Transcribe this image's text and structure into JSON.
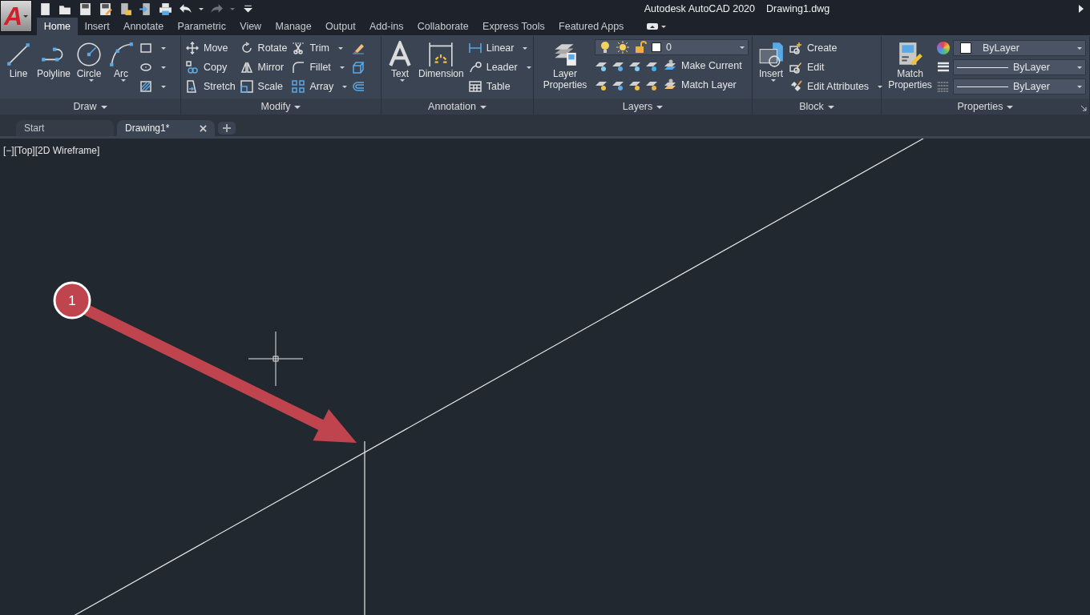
{
  "title_bar": {
    "app_button": "A",
    "product": "Autodesk AutoCAD 2020",
    "file": "Drawing1.dwg"
  },
  "ribbon_tabs": [
    {
      "label": "Home",
      "selected": true
    },
    {
      "label": "Insert",
      "selected": false
    },
    {
      "label": "Annotate",
      "selected": false
    },
    {
      "label": "Parametric",
      "selected": false
    },
    {
      "label": "View",
      "selected": false
    },
    {
      "label": "Manage",
      "selected": false
    },
    {
      "label": "Output",
      "selected": false
    },
    {
      "label": "Add-ins",
      "selected": false
    },
    {
      "label": "Collaborate",
      "selected": false
    },
    {
      "label": "Express Tools",
      "selected": false
    },
    {
      "label": "Featured Apps",
      "selected": false
    }
  ],
  "panels": [
    {
      "title": "Draw",
      "columns": [
        {
          "kind": "large",
          "label": "Line",
          "dropdown": false
        },
        {
          "kind": "large",
          "label": "Polyline",
          "dropdown": false
        },
        {
          "kind": "large",
          "label": "Circle",
          "dropdown": true
        },
        {
          "kind": "large",
          "label": "Arc",
          "dropdown": true
        },
        {
          "kind": "stack",
          "items": [
            {
              "dropdown": true
            },
            {
              "dropdown": true
            },
            {
              "dropdown": true
            }
          ]
        }
      ]
    },
    {
      "title": "Modify",
      "columns": [
        {
          "kind": "stack",
          "items": [
            {
              "label": "Move",
              "dropdown": false
            },
            {
              "label": "Copy",
              "dropdown": false
            },
            {
              "label": "Stretch",
              "dropdown": false
            }
          ]
        },
        {
          "kind": "stack",
          "items": [
            {
              "label": "Rotate",
              "dropdown": false
            },
            {
              "label": "Mirror",
              "dropdown": false
            },
            {
              "label": "Scale",
              "dropdown": false
            }
          ]
        },
        {
          "kind": "stack",
          "items": [
            {
              "label": "Trim",
              "dropdown": true
            },
            {
              "label": "Fillet",
              "dropdown": true
            },
            {
              "label": "Array",
              "dropdown": true
            }
          ]
        },
        {
          "kind": "stack",
          "items": [
            {
              "dropdown": false
            },
            {
              "dropdown": false
            },
            {
              "dropdown": false
            }
          ]
        }
      ]
    },
    {
      "title": "Annotation",
      "columns": [
        {
          "kind": "large",
          "label": "Text",
          "dropdown": true
        },
        {
          "kind": "large",
          "label": "Dimension",
          "dropdown": false
        },
        {
          "kind": "stack",
          "items": [
            {
              "label": "Linear",
              "dropdown": true
            },
            {
              "label": "Leader",
              "dropdown": true
            },
            {
              "label": "Table",
              "dropdown": false
            }
          ]
        }
      ]
    },
    {
      "title": "Layers",
      "columns": [
        {
          "kind": "large",
          "label": "Layer Properties",
          "dropdown": false
        },
        {
          "kind": "layers",
          "current_layer": "0",
          "rows": [
            {
              "label": "Make Current"
            },
            {
              "label": "Match Layer"
            }
          ]
        }
      ]
    },
    {
      "title": "Block",
      "columns": [
        {
          "kind": "large",
          "label": "Insert",
          "dropdown": true
        },
        {
          "kind": "stack",
          "items": [
            {
              "label": "Create",
              "dropdown": false
            },
            {
              "label": "Edit",
              "dropdown": false
            },
            {
              "label": "Edit Attributes",
              "dropdown": true
            }
          ]
        }
      ]
    },
    {
      "title": "Properties",
      "columns": [
        {
          "kind": "large",
          "label": "Match Properties",
          "dropdown": false
        },
        {
          "kind": "properties",
          "rows": [
            {
              "kind": "color",
              "value": "ByLayer"
            },
            {
              "kind": "lineweight",
              "value": "ByLayer"
            },
            {
              "kind": "linetype",
              "value": "ByLayer"
            }
          ]
        }
      ]
    }
  ],
  "document_tabs": [
    {
      "label": "Start",
      "selected": false
    },
    {
      "label": "Drawing1*",
      "selected": true
    }
  ],
  "viewport_label": "[−][Top][2D Wireframe]",
  "callout": {
    "number": "1"
  }
}
